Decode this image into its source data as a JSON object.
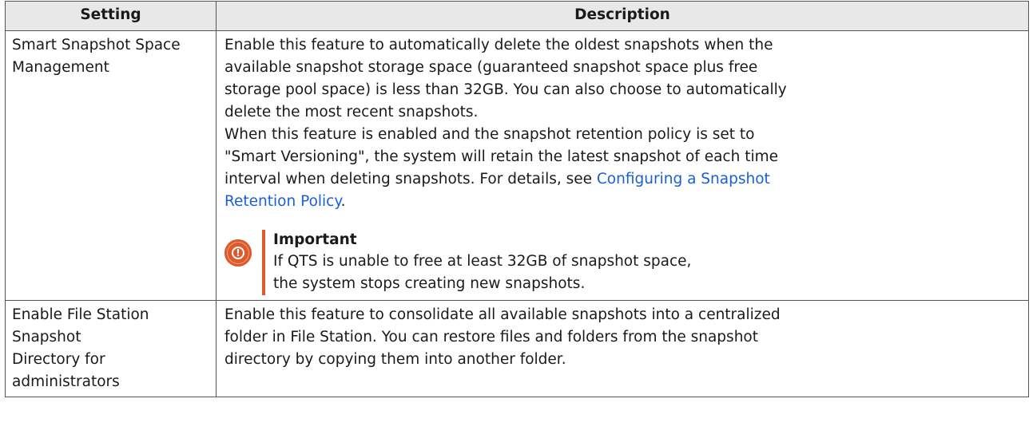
{
  "table": {
    "headers": {
      "setting": "Setting",
      "description": "Description"
    },
    "rows": [
      {
        "setting_line1": "Smart Snapshot Space",
        "setting_line2": "Management",
        "desc_lines": [
          "Enable this feature to automatically delete the oldest snapshots when the",
          "available snapshot storage space (guaranteed snapshot space plus free",
          "storage pool space) is less than 32GB. You can also choose to automatically",
          "delete the most recent snapshots.",
          "When this feature is enabled and the snapshot retention policy is set to",
          "\"Smart Versioning\", the system will retain the latest snapshot of each time",
          "interval when deleting snapshots. For details, see "
        ],
        "link_line1": "Configuring a Snapshot",
        "link_line2": "Retention Policy",
        "after_link": ".",
        "callout": {
          "icon": "important-icon",
          "title": "Important",
          "line1": "If QTS is unable to free at least 32GB of snapshot space,",
          "line2": "the system stops creating new snapshots."
        }
      },
      {
        "setting_line1": "Enable File Station Snapshot",
        "setting_line2": "Directory for administrators",
        "desc_lines": [
          "Enable this feature to consolidate all available snapshots into a centralized",
          "folder in File Station. You can restore files and folders from the snapshot",
          "directory by copying them into another folder."
        ]
      }
    ]
  },
  "colors": {
    "header_bg": "#e8e8e8",
    "link": "#1a5fd6",
    "important_accent": "#dd5a2c"
  }
}
